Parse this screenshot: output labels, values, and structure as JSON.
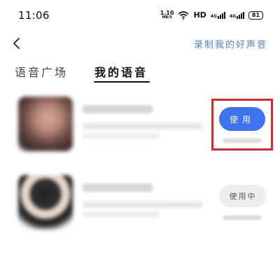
{
  "status_bar": {
    "time": "11:06",
    "net_speed_value": "1.10",
    "net_speed_unit": "MB/S",
    "hd_label": "HD",
    "signal_1_label": "4G",
    "signal_2_label": "4G",
    "battery_level": "81"
  },
  "header": {
    "back_icon": "chevron-left-icon",
    "record_link": "录制我的好声音"
  },
  "tabs": [
    {
      "label": "语音广场",
      "selected": false
    },
    {
      "label": "我的语音",
      "selected": true
    }
  ],
  "voice_items": [
    {
      "button_label": "使用",
      "button_state": "available",
      "highlighted": true
    },
    {
      "button_label": "使用中",
      "button_state": "in-use",
      "highlighted": false
    }
  ],
  "colors": {
    "accent_blue": "#3d73ef",
    "link_blue": "#4a7fe0",
    "highlight_red": "#e3262a",
    "in_use_bg": "#eeeeee"
  }
}
